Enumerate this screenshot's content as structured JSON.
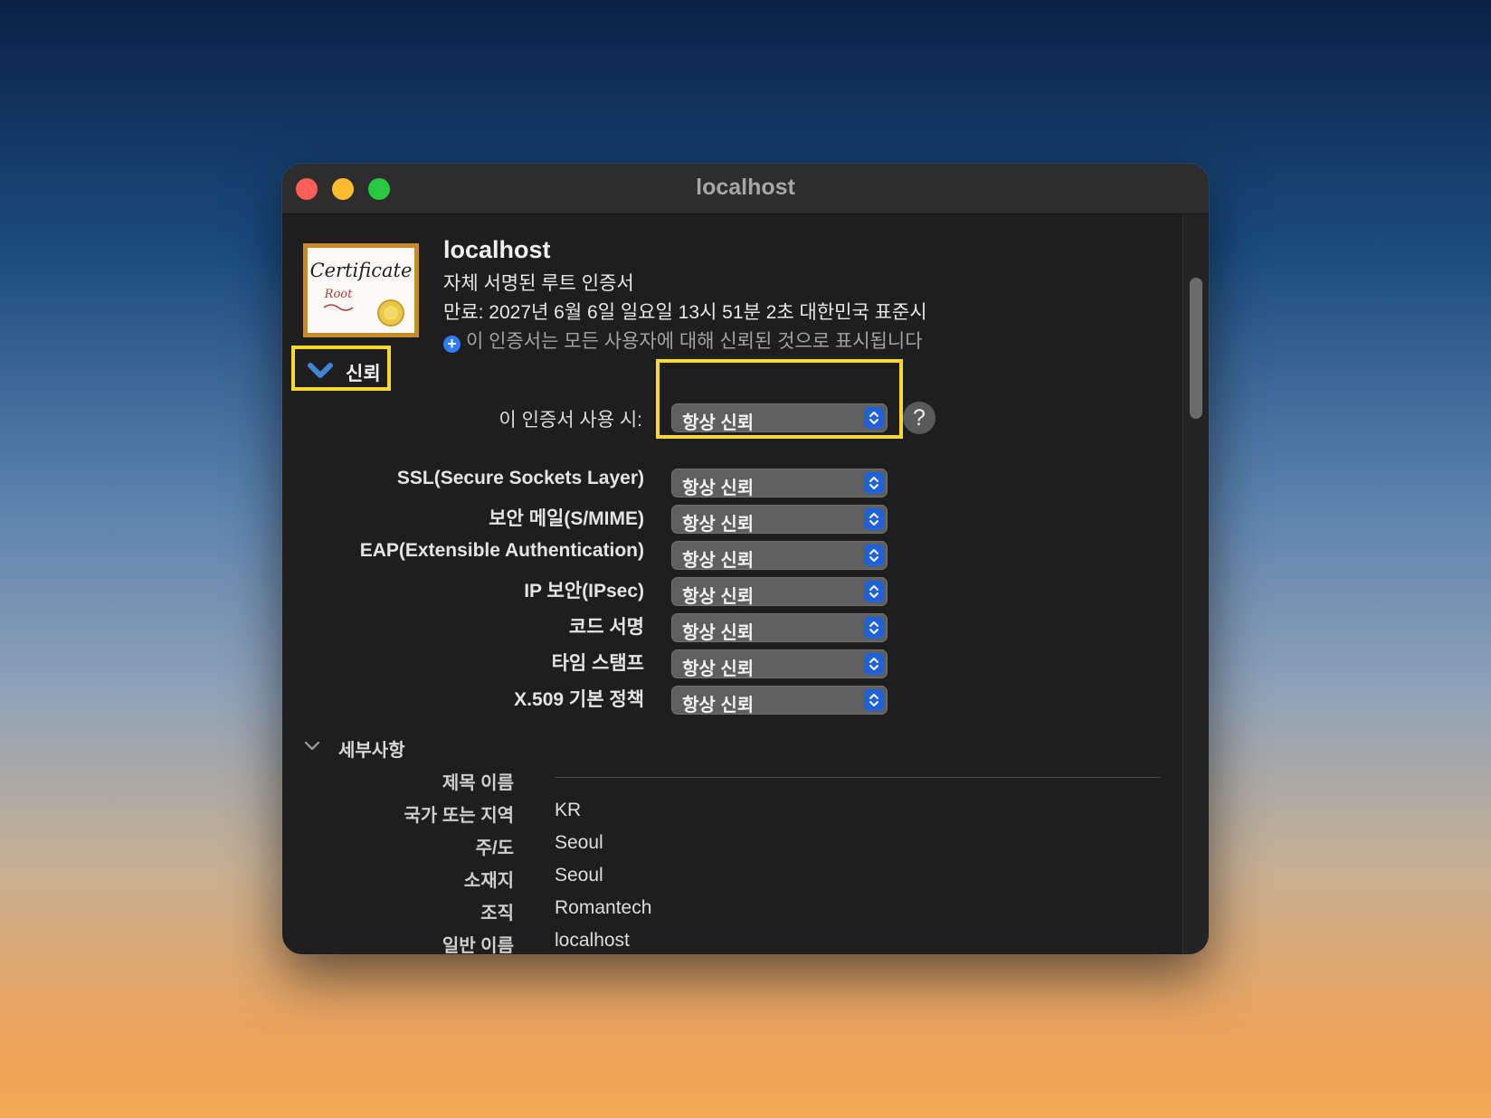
{
  "window": {
    "title": "localhost"
  },
  "certificate": {
    "icon_text": "Certificate",
    "icon_subtext": "Root",
    "name": "localhost",
    "kind": "자체 서명된 루트 인증서",
    "expiry": "만료: 2027년 6월 6일 일요일 13시 51분 2초 대한민국 표준시",
    "status": "이 인증서는 모든 사용자에 대해 신뢰된 것으로 표시됩니다",
    "status_icon": "plus-circle-icon"
  },
  "trust": {
    "section_label": "신뢰",
    "use_label": "이 인증서 사용 시:",
    "use_value": "항상 신뢰",
    "help_label": "?",
    "policies": [
      {
        "label": "SSL(Secure Sockets Layer)",
        "value": "항상 신뢰"
      },
      {
        "label": "보안 메일(S/MIME)",
        "value": "항상 신뢰"
      },
      {
        "label": "EAP(Extensible Authentication)",
        "value": "항상 신뢰"
      },
      {
        "label": "IP 보안(IPsec)",
        "value": "항상 신뢰"
      },
      {
        "label": "코드 서명",
        "value": "항상 신뢰"
      },
      {
        "label": "타임 스탬프",
        "value": "항상 신뢰"
      },
      {
        "label": "X.509 기본 정책",
        "value": "항상 신뢰"
      }
    ]
  },
  "details": {
    "section_label": "세부사항",
    "subject_heading": "제목 이름",
    "fields": [
      {
        "label": "국가 또는 지역",
        "value": "KR"
      },
      {
        "label": "주/도",
        "value": "Seoul"
      },
      {
        "label": "소재지",
        "value": "Seoul"
      },
      {
        "label": "조직",
        "value": "Romantech"
      },
      {
        "label": "일반 이름",
        "value": "localhost"
      }
    ]
  },
  "colors": {
    "highlight": "#f8d92c",
    "accent": "#1f62d8",
    "window_bg": "#1e1e1e"
  }
}
